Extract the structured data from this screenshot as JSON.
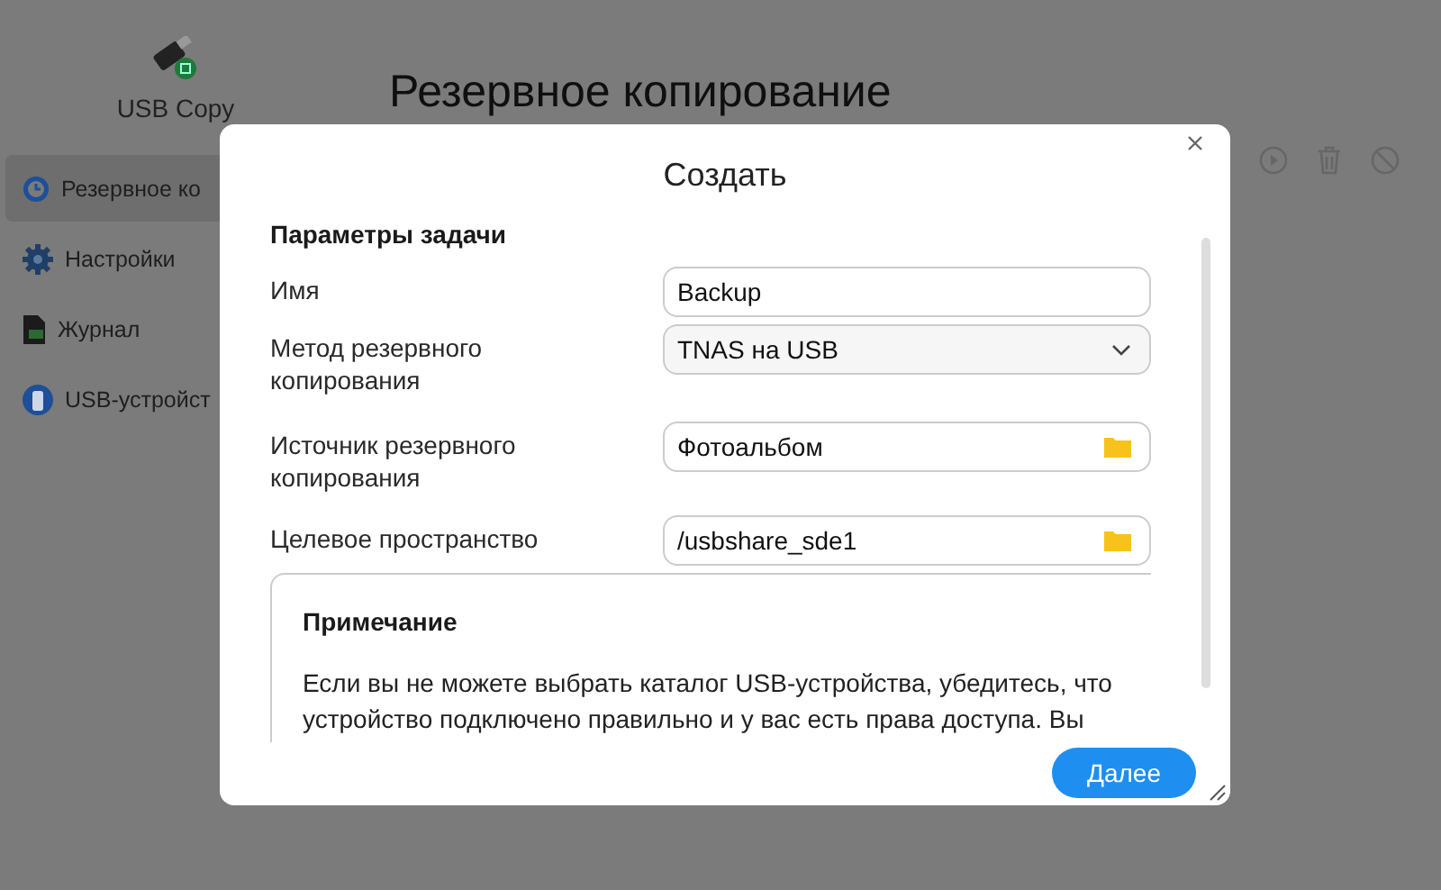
{
  "app": {
    "name": "USB Copy"
  },
  "sidebar": {
    "items": [
      {
        "label": "Резервное ко",
        "selected": true
      },
      {
        "label": "Настройки",
        "selected": false
      },
      {
        "label": "Журнал",
        "selected": false
      },
      {
        "label": "USB-устройст",
        "selected": false
      }
    ]
  },
  "page": {
    "title": "Резервное копирование"
  },
  "dialog": {
    "title": "Создать",
    "section": "Параметры задачи",
    "fields": [
      {
        "label": "Имя",
        "kind": "text",
        "value": "Backup"
      },
      {
        "label": "Метод резервного копирования",
        "kind": "select",
        "value": "TNAS на USB"
      },
      {
        "label": "Источник резервного копирования",
        "kind": "folder",
        "value": "Фотоальбом"
      },
      {
        "label": "Целевое пространство",
        "kind": "folder",
        "value": "/usbshare_sde1"
      }
    ],
    "note": {
      "title": "Примечание",
      "text": "Если вы не можете выбрать каталог USB-устройства, убедитесь, что устройство подключено правильно и у вас есть права доступа. Вы"
    },
    "button": "Далее"
  }
}
